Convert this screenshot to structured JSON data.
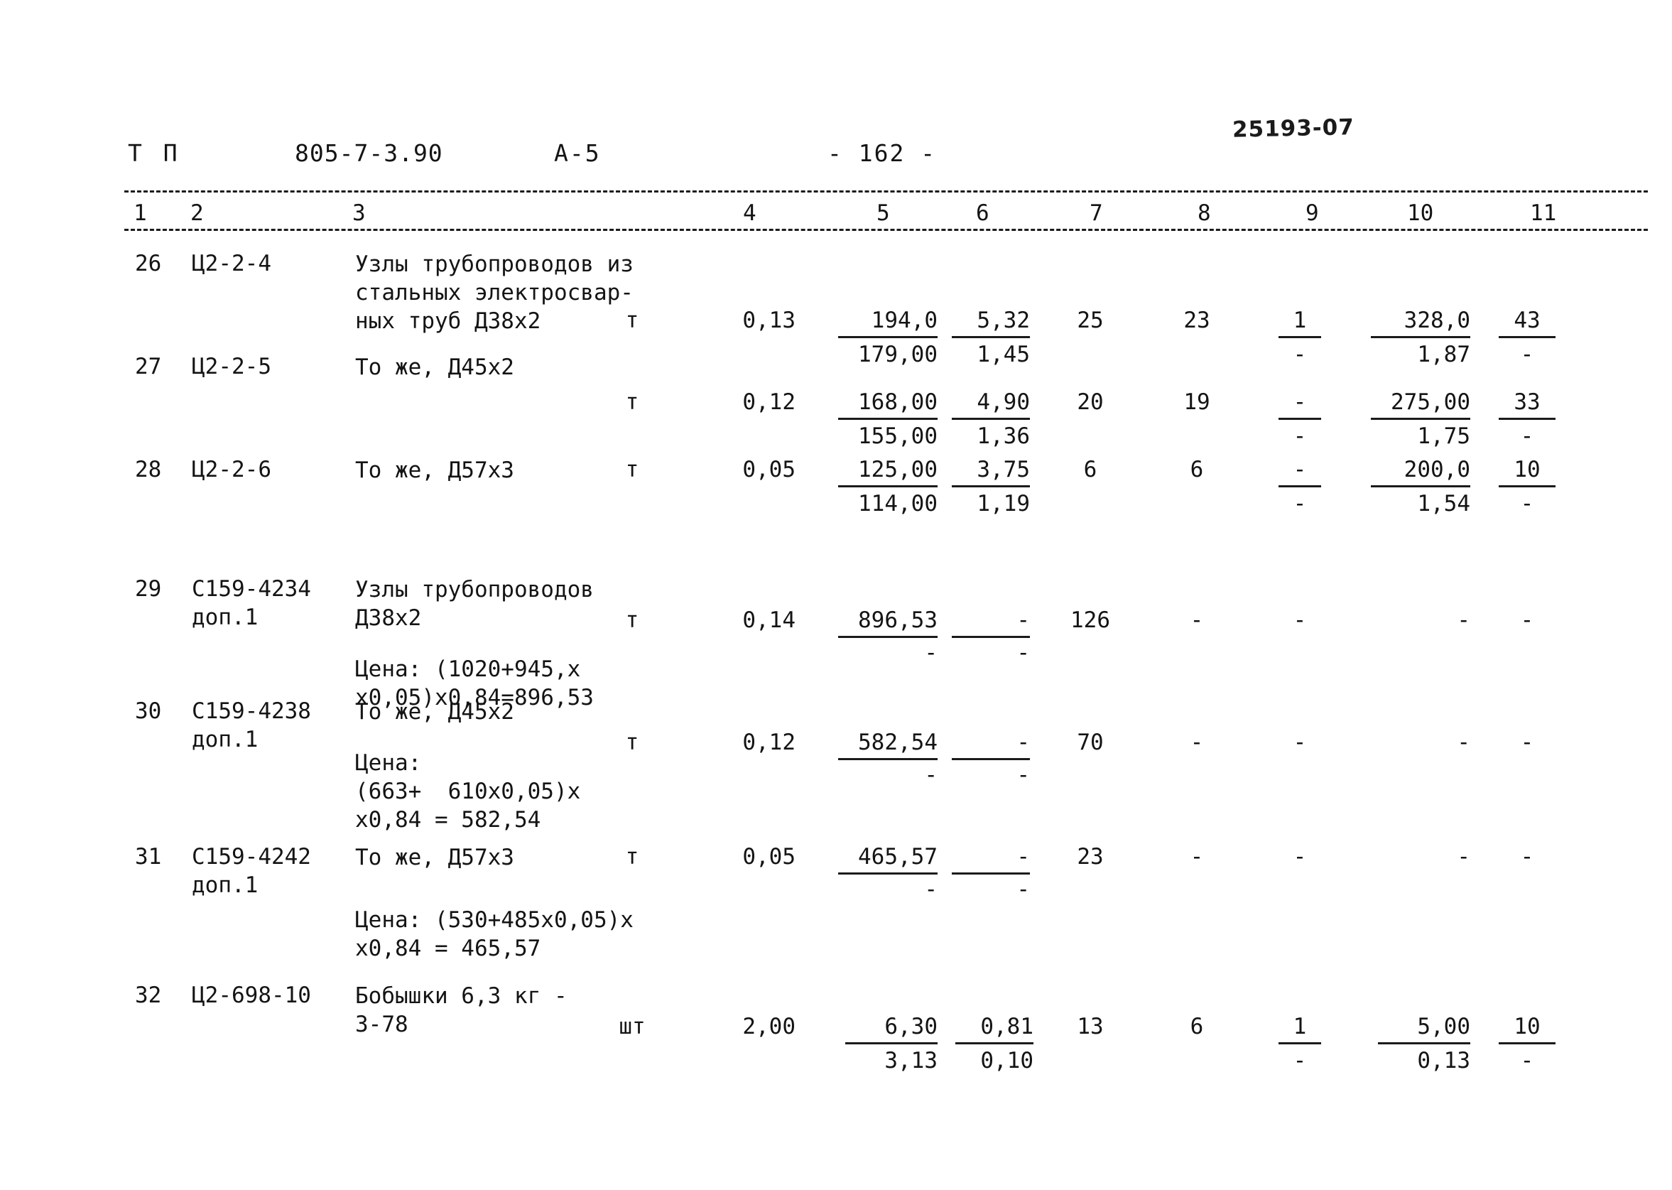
{
  "header": {
    "doc_type": "Т П",
    "doc_code": "805-7-3.90",
    "sheet": "А-5",
    "page_label": "- 162 -",
    "archive_stamp": "25193-07"
  },
  "table": {
    "column_numbers": [
      "1",
      "2",
      "3",
      "4",
      "5",
      "6",
      "7",
      "8",
      "9",
      "10",
      "11"
    ],
    "rows": [
      {
        "no": "26",
        "code": "Ц2-2-4",
        "code2": "",
        "desc": "Узлы трубопроводов из\nстальных электросвар-\nных труб Д38х2",
        "note": "",
        "unit": "т",
        "qty": "0,13",
        "c5_top": "194,0",
        "c5_bot": "179,00",
        "c6_top": "5,32",
        "c6_bot": "1,45",
        "c7": "25",
        "c8": "23",
        "c9_top": "1",
        "c9_bot": "-",
        "c10_top": "328,0",
        "c10_bot": "1,87",
        "c11_top": "43",
        "c11_bot": "-"
      },
      {
        "no": "27",
        "code": "Ц2-2-5",
        "code2": "",
        "desc": "То же, Д45х2",
        "note": "",
        "unit": "т",
        "qty": "0,12",
        "c5_top": "168,00",
        "c5_bot": "155,00",
        "c6_top": "4,90",
        "c6_bot": "1,36",
        "c7": "20",
        "c8": "19",
        "c9_top": "-",
        "c9_bot": "-",
        "c10_top": "275,00",
        "c10_bot": "1,75",
        "c11_top": "33",
        "c11_bot": "-"
      },
      {
        "no": "28",
        "code": "Ц2-2-6",
        "code2": "",
        "desc": "То же, Д57х3",
        "note": "",
        "unit": "т",
        "qty": "0,05",
        "c5_top": "125,00",
        "c5_bot": "114,00",
        "c6_top": "3,75",
        "c6_bot": "1,19",
        "c7": "6",
        "c8": "6",
        "c9_top": "-",
        "c9_bot": "-",
        "c10_top": "200,0",
        "c10_bot": "1,54",
        "c11_top": "10",
        "c11_bot": "-"
      },
      {
        "no": "29",
        "code": "С159-4234",
        "code2": "доп.1",
        "desc": "Узлы трубопроводов\nД38х2",
        "note": "Цена: (1020+945,х\nх0,05)х0,84=896,53",
        "unit": "т",
        "qty": "0,14",
        "c5_top": "896,53",
        "c5_bot": "-",
        "c6_top": "-",
        "c6_bot": "-",
        "c7": "126",
        "c8": "-",
        "c9_top": "-",
        "c9_bot": "",
        "c10_top": "-",
        "c10_bot": "",
        "c11_top": "-",
        "c11_bot": ""
      },
      {
        "no": "30",
        "code": "С159-4238",
        "code2": "доп.1",
        "desc": "То же, Д45х2",
        "note": "Цена:\n(663+  610х0,05)х\nх0,84 = 582,54",
        "unit": "т",
        "qty": "0,12",
        "c5_top": "582,54",
        "c5_bot": "-",
        "c6_top": "-",
        "c6_bot": "-",
        "c7": "70",
        "c8": "-",
        "c9_top": "-",
        "c9_bot": "",
        "c10_top": "-",
        "c10_bot": "",
        "c11_top": "-",
        "c11_bot": ""
      },
      {
        "no": "31",
        "code": "С159-4242",
        "code2": "доп.1",
        "desc": "То же, Д57х3",
        "note": "Цена: (530+485х0,05)х\nх0,84 = 465,57",
        "unit": "т",
        "qty": "0,05",
        "c5_top": "465,57",
        "c5_bot": "-",
        "c6_top": "-",
        "c6_bot": "-",
        "c7": "23",
        "c8": "-",
        "c9_top": "-",
        "c9_bot": "",
        "c10_top": "-",
        "c10_bot": "",
        "c11_top": "-",
        "c11_bot": ""
      },
      {
        "no": "32",
        "code": "Ц2-698-10",
        "code2": "",
        "desc": "Бобышки 6,3 кг -\n3-78",
        "note": "",
        "unit": "шт",
        "qty": "2,00",
        "c5_top": "6,30",
        "c5_bot": "3,13",
        "c6_top": "0,81",
        "c6_bot": "0,10",
        "c7": "13",
        "c8": "6",
        "c9_top": "1",
        "c9_bot": "-",
        "c10_top": "5,00",
        "c10_bot": "0,13",
        "c11_top": "10",
        "c11_bot": "-"
      }
    ]
  }
}
